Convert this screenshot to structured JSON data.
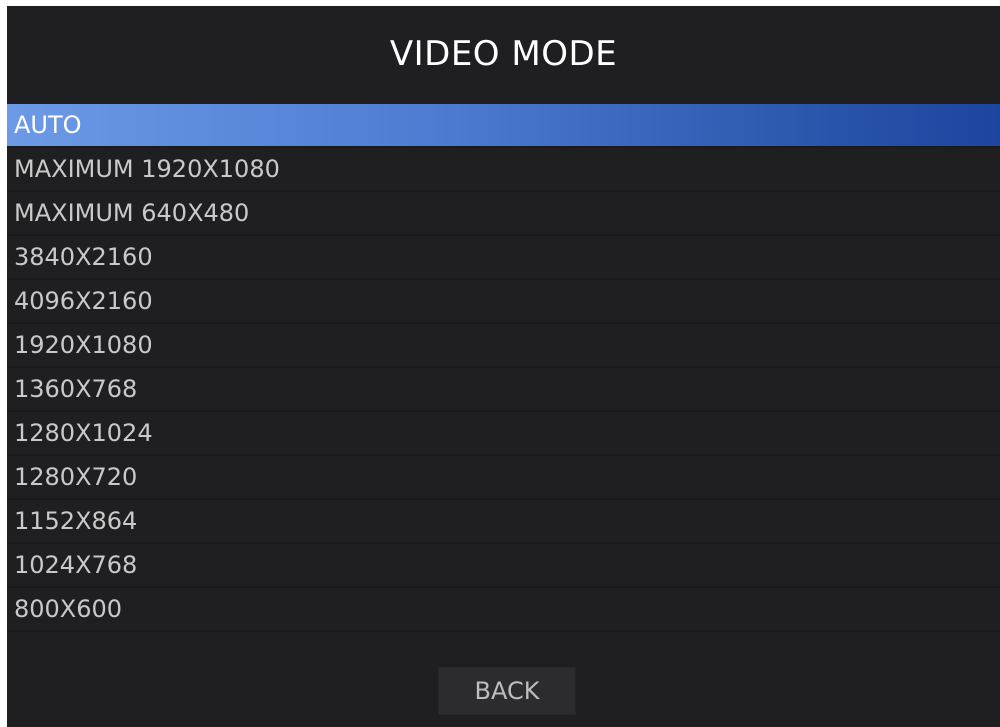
{
  "title": "VIDEO MODE",
  "modes": [
    {
      "label": "AUTO",
      "selected": true
    },
    {
      "label": "MAXIMUM 1920X1080",
      "selected": false
    },
    {
      "label": "MAXIMUM 640X480",
      "selected": false
    },
    {
      "label": "3840X2160",
      "selected": false
    },
    {
      "label": "4096X2160",
      "selected": false
    },
    {
      "label": "1920X1080",
      "selected": false
    },
    {
      "label": "1360X768",
      "selected": false
    },
    {
      "label": "1280X1024",
      "selected": false
    },
    {
      "label": "1280X720",
      "selected": false
    },
    {
      "label": "1152X864",
      "selected": false
    },
    {
      "label": "1024X768",
      "selected": false
    },
    {
      "label": "800X600",
      "selected": false
    }
  ],
  "back_label": "BACK",
  "colors": {
    "background": "#1f1f21",
    "highlight_start": "#6c9ae6",
    "highlight_end": "#1d45a0",
    "text": "#c9c9c9",
    "title_text": "#ffffff"
  }
}
